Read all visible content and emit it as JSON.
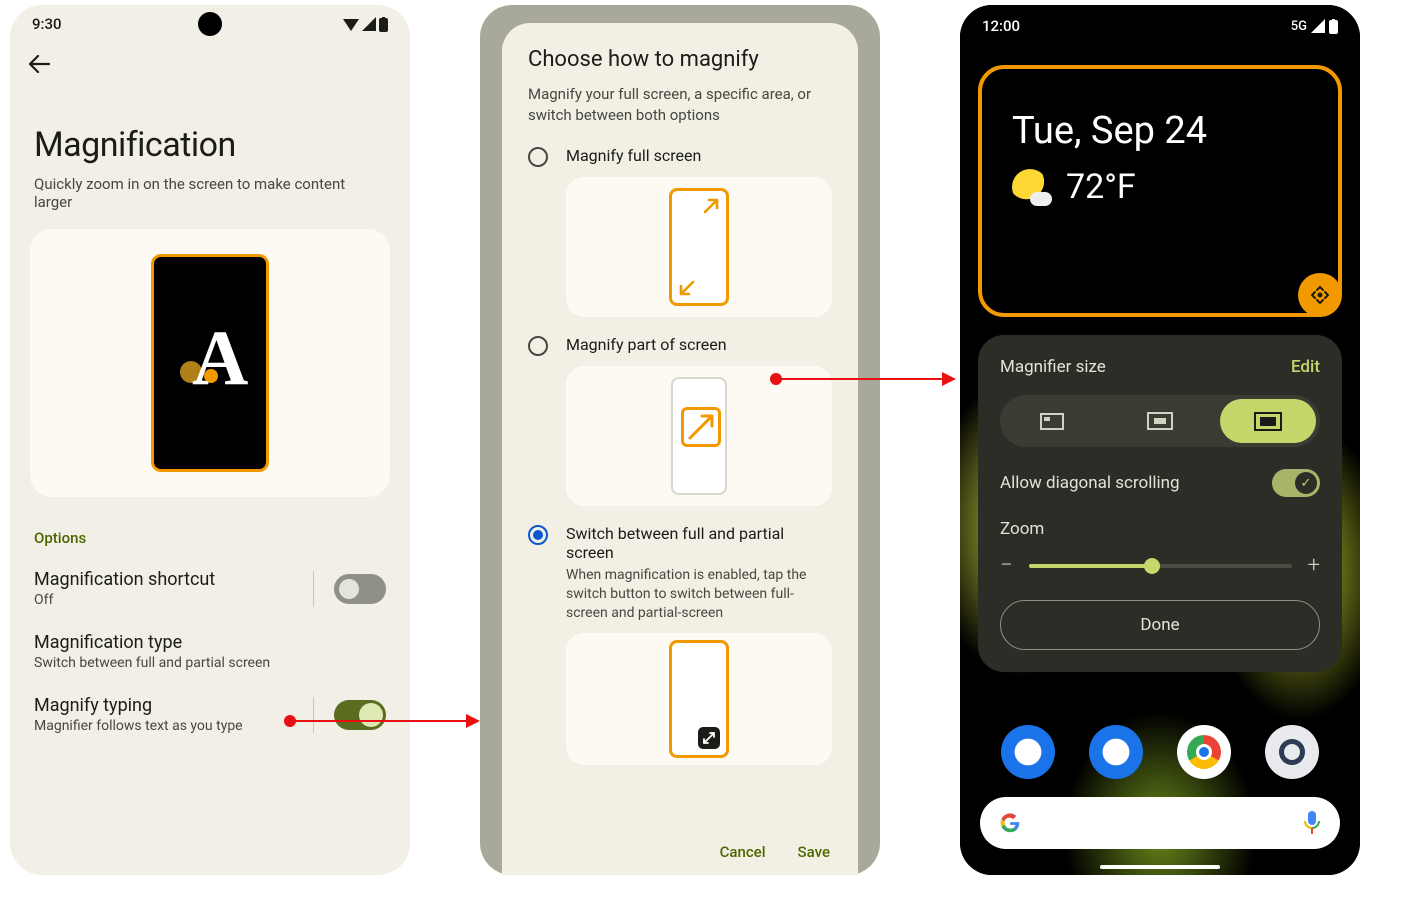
{
  "phone1": {
    "status_time": "9:30",
    "title": "Magnification",
    "subtitle": "Quickly zoom in on the screen to make content larger",
    "preview_letter": "A",
    "section_options": "Options",
    "row_shortcut": {
      "label": "Magnification shortcut",
      "value": "Off"
    },
    "row_type": {
      "label": "Magnification type",
      "value": "Switch between full and partial screen"
    },
    "row_typing": {
      "label": "Magnify typing",
      "value": "Magnifier follows text as you type"
    }
  },
  "phone2": {
    "title": "Choose how to magnify",
    "subtitle": "Magnify your full screen, a specific area, or switch between both options",
    "opt_full": "Magnify full screen",
    "opt_part": "Magnify part of screen",
    "opt_switch": "Switch between full and partial screen",
    "opt_switch_desc": "When magnification is enabled, tap the switch button to switch between full-screen and partial-screen",
    "cancel": "Cancel",
    "save": "Save"
  },
  "phone3": {
    "status_time": "12:00",
    "status_net": "5G",
    "date": "Tue, Sep 24",
    "temp": "72°F",
    "panel_title": "Magnifier size",
    "edit": "Edit",
    "allow_diag": "Allow diagonal scrolling",
    "zoom": "Zoom",
    "done": "Done"
  }
}
